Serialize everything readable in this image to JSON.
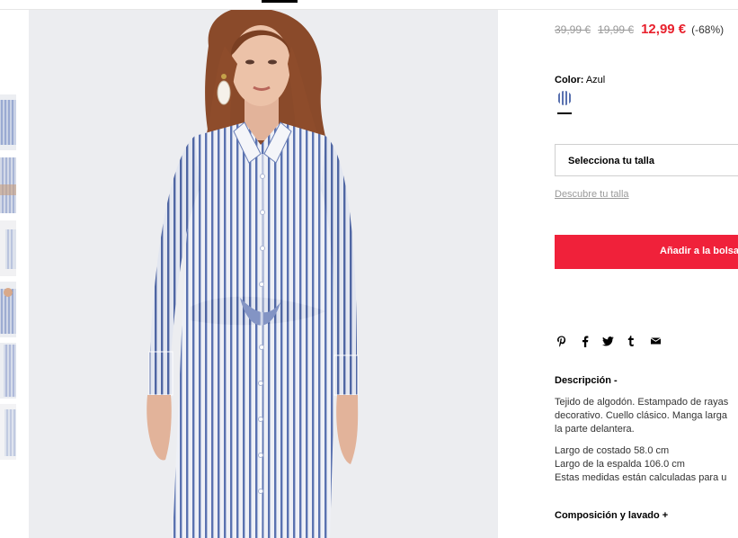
{
  "price": {
    "original_1": "39,99 €",
    "original_2": "19,99 €",
    "current": "12,99 €",
    "discount": "(-68%)"
  },
  "color": {
    "label": "Color:",
    "value": "Azul"
  },
  "size": {
    "select_label": "Selecciona tu talla",
    "guide_link": "Descubre tu talla"
  },
  "cart": {
    "add_label": "Añadir a la bolsa"
  },
  "share_icons": [
    "pinterest-icon",
    "facebook-icon",
    "twitter-icon",
    "tumblr-icon",
    "mail-icon"
  ],
  "description": {
    "title": "Descripción -",
    "lines": [
      "Tejido de algodón. Estampado de rayas",
      "decorativo. Cuello clásico. Manga larga",
      "la parte delantera.",
      "Largo de costado 58.0 cm",
      "Largo de la espalda 106.0 cm",
      "Estas medidas están calculadas para u"
    ]
  },
  "composition": {
    "title": "Composición y lavado +"
  },
  "colors": {
    "accent": "#e8212d",
    "button": "#f0213a",
    "stripe_blue": "#5a72b0"
  }
}
